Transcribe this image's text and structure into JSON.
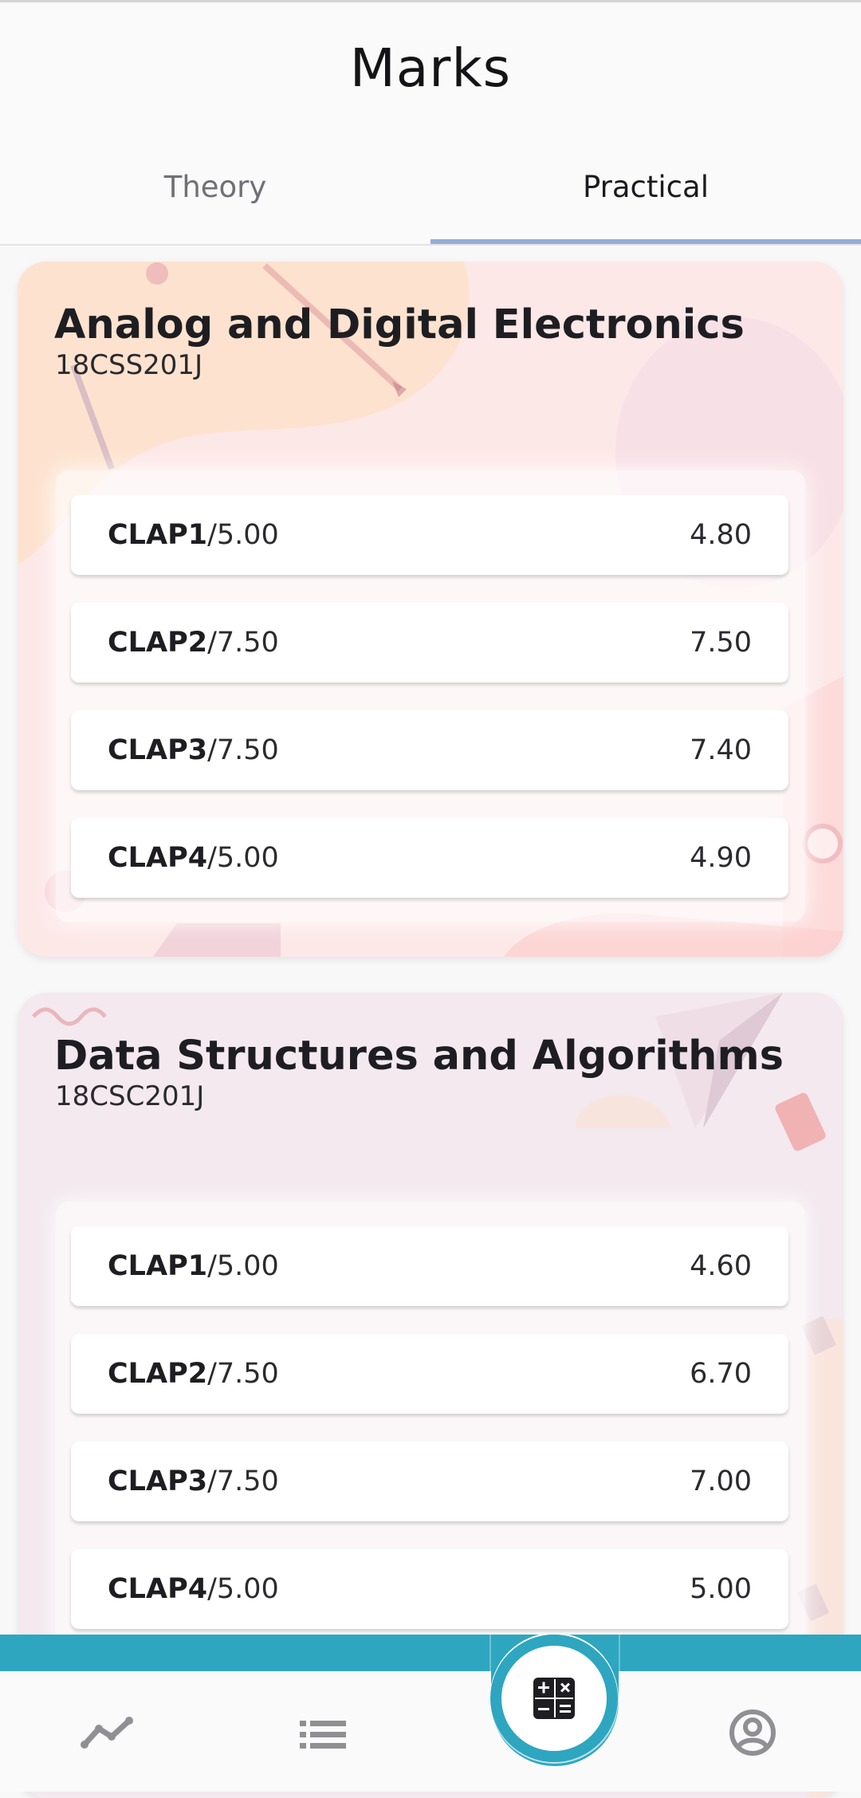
{
  "header": {
    "title": "Marks"
  },
  "tabs": [
    {
      "label": "Theory",
      "active": false
    },
    {
      "label": "Practical",
      "active": true
    }
  ],
  "courses": [
    {
      "name": "Analog and Digital Electronics",
      "code": "18CSS201J",
      "marks": [
        {
          "test": "CLAP1",
          "max": "/5.00",
          "score": "4.80"
        },
        {
          "test": "CLAP2",
          "max": "/7.50",
          "score": "7.50"
        },
        {
          "test": "CLAP3",
          "max": "/7.50",
          "score": "7.40"
        },
        {
          "test": "CLAP4",
          "max": "/5.00",
          "score": "4.90"
        }
      ]
    },
    {
      "name": "Data Structures and Algorithms",
      "code": "18CSC201J",
      "marks": [
        {
          "test": "CLAP1",
          "max": "/5.00",
          "score": "4.60"
        },
        {
          "test": "CLAP2",
          "max": "/7.50",
          "score": "6.70"
        },
        {
          "test": "CLAP3",
          "max": "/7.50",
          "score": "7.00"
        },
        {
          "test": "CLAP4",
          "max": "/5.00",
          "score": "5.00"
        }
      ]
    }
  ],
  "bottom_nav": {
    "items": [
      {
        "icon": "trend-line-icon"
      },
      {
        "icon": "list-icon"
      },
      {
        "icon": "calculator-icon",
        "active": true
      },
      {
        "icon": "account-circle-icon"
      }
    ],
    "colors": {
      "band": "#2ea6c0",
      "icon": "#8f8f94",
      "active_icon": "#1e1e22"
    }
  }
}
